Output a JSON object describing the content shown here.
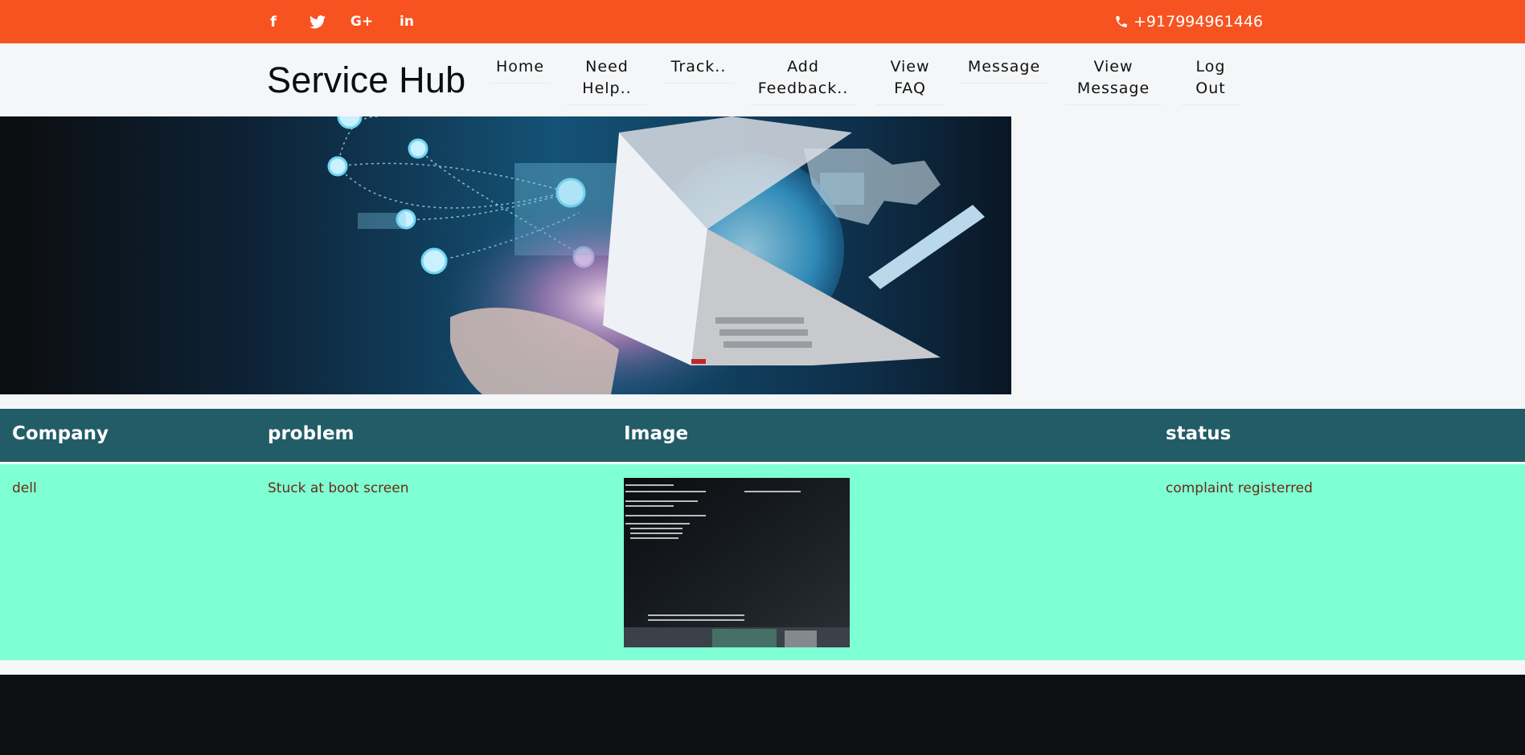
{
  "topbar": {
    "social": [
      {
        "name": "facebook-icon",
        "glyph": "f"
      },
      {
        "name": "twitter-icon",
        "glyph": "t"
      },
      {
        "name": "google-plus-icon",
        "glyph": "G+"
      },
      {
        "name": "linkedin-icon",
        "glyph": "in"
      }
    ],
    "phone": "+917994961446",
    "color": "#f75320"
  },
  "navbar": {
    "brand": "Service Hub",
    "items": [
      {
        "line1": "Home",
        "line2": ""
      },
      {
        "line1": "Need",
        "line2": "Help.."
      },
      {
        "line1": "Track..",
        "line2": ""
      },
      {
        "line1": "Add",
        "line2": "Feedback.."
      },
      {
        "line1": "View",
        "line2": "FAQ"
      },
      {
        "line1": "Message",
        "line2": ""
      },
      {
        "line1": "View",
        "line2": "Message"
      },
      {
        "line1": "Log",
        "line2": "Out"
      }
    ]
  },
  "table": {
    "headers": [
      "Company",
      "problem",
      "Image",
      "status"
    ],
    "rows": [
      {
        "company": "dell",
        "problem": "Stuck at boot screen",
        "status": "complaint registerred"
      }
    ],
    "header_color": "#225c67",
    "row_color": "#7fffd4"
  }
}
